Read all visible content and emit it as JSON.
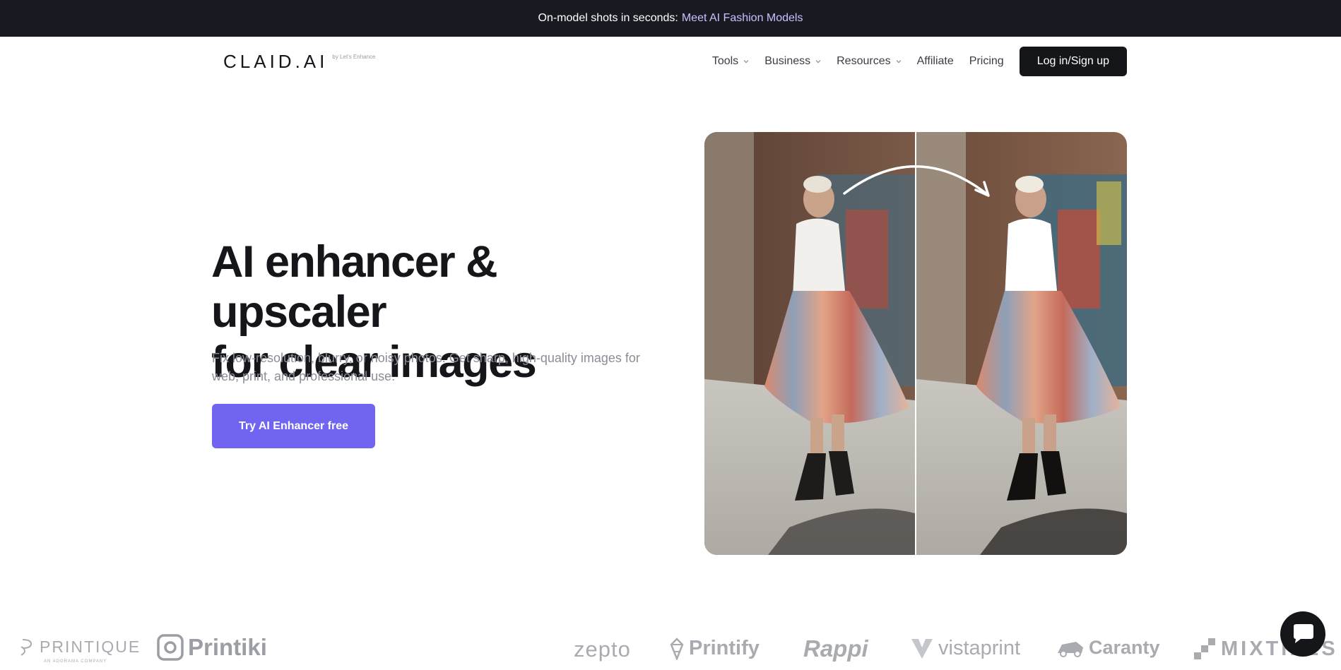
{
  "announcement": {
    "lead": "On-model shots in seconds:",
    "link": "Meet AI Fashion Models"
  },
  "header": {
    "logo": "CLAID.AI",
    "logo_sub": "by Let's Enhance",
    "nav": [
      {
        "label": "Tools",
        "dropdown": true
      },
      {
        "label": "Business",
        "dropdown": true
      },
      {
        "label": "Resources",
        "dropdown": true
      },
      {
        "label": "Affiliate",
        "dropdown": false
      },
      {
        "label": "Pricing",
        "dropdown": false
      }
    ],
    "login_label": "Log in/Sign up"
  },
  "hero": {
    "title_line1": "AI enhancer & upscaler",
    "title_line2": "for clear images",
    "subtitle": "Fix low-resolution, blurry, or noisy photos. Get sharp, high-quality images for web, print, and professional use.",
    "cta_label": "Try AI Enhancer free"
  },
  "logos": {
    "printique": "PRINTIQUE",
    "printique_sub": "AN ADORAMA COMPANY",
    "printiki": "Printiki",
    "zepto": "zepto",
    "printify": "Printify",
    "rappi": "Rappi",
    "vistaprint": "vistaprint",
    "caranty": "Caranty",
    "mixtiles": "MIXTILES"
  },
  "colors": {
    "brand_dark": "#15161a",
    "cta": "#7064f0",
    "link_accent": "#c9c0ff"
  },
  "icons": {
    "nav_dropdown": "chevron-down-icon",
    "chat": "chat-icon",
    "compare_arrow": "curved-arrow-icon"
  }
}
